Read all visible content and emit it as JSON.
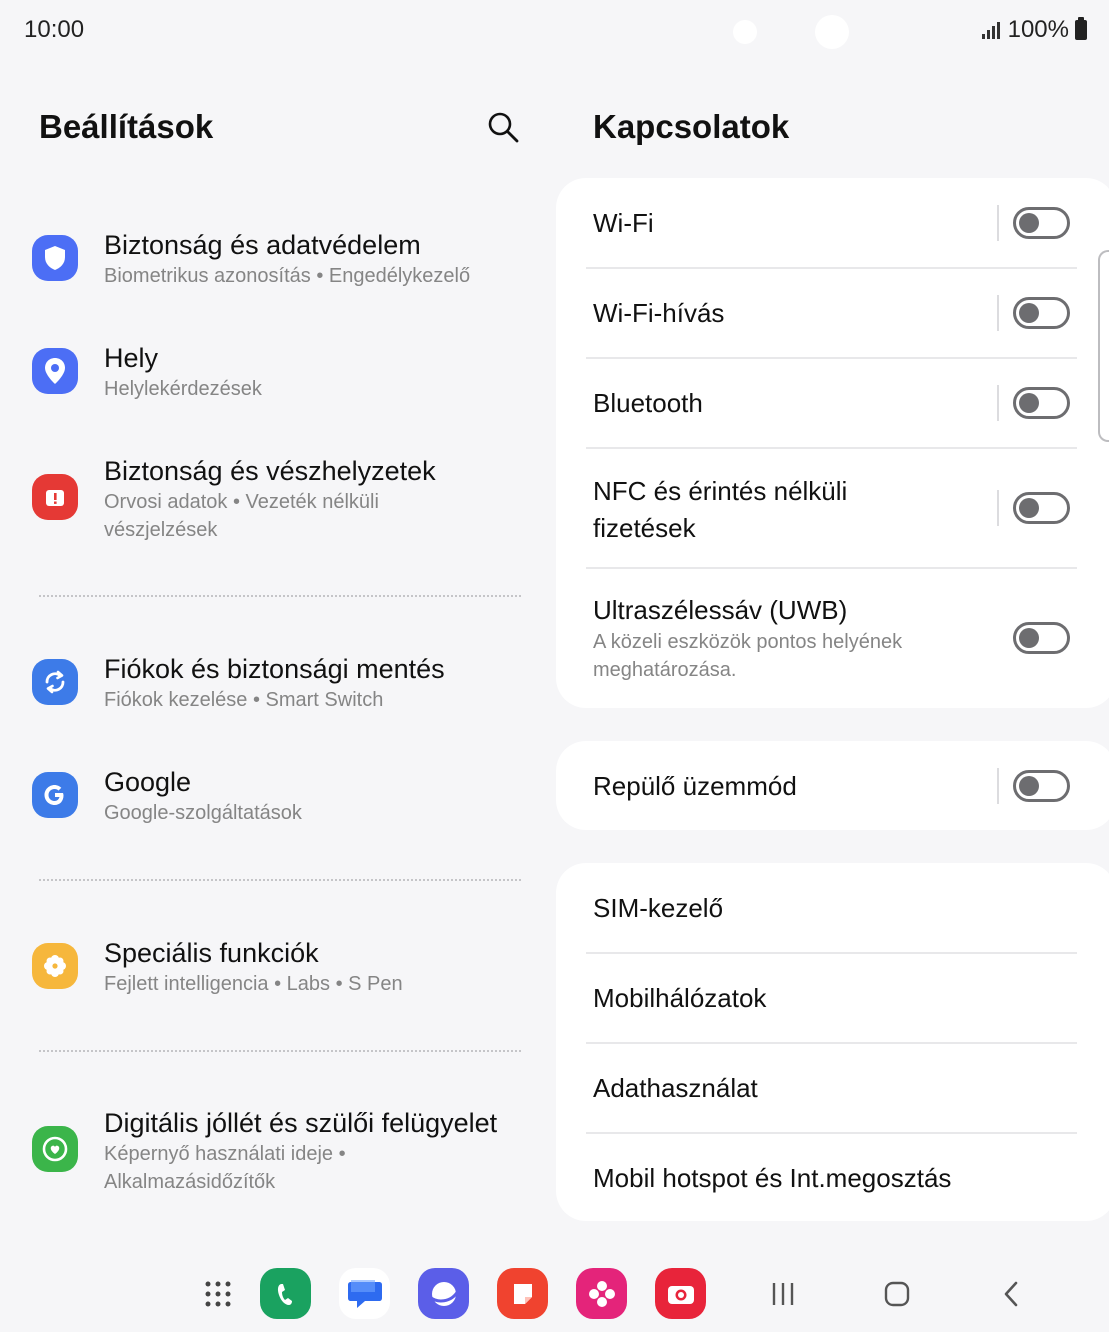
{
  "status_bar": {
    "time": "10:00",
    "battery": "100%"
  },
  "left_pane": {
    "title": "Beállítások",
    "items": [
      {
        "title": "Biztonság és adatvédelem",
        "subtitle": "Biometrikus azonosítás  •  Engedélykezelő",
        "icon": "shield-icon",
        "color": "#4c6ef5"
      },
      {
        "title": "Hely",
        "subtitle": "Helylekérdezések",
        "icon": "location-pin-icon",
        "color": "#4c6ef5"
      },
      {
        "title": "Biztonság és vészhelyzetek",
        "subtitle": "Orvosi adatok  •  Vezeték nélküli vészjelzések",
        "icon": "emergency-alert-icon",
        "color": "#e53935"
      },
      {
        "title": "Fiókok és biztonsági mentés",
        "subtitle": "Fiókok kezelése  •  Smart Switch",
        "icon": "sync-icon",
        "color": "#3d7be8"
      },
      {
        "title": "Google",
        "subtitle": "Google-szolgáltatások",
        "icon": "google-g-icon",
        "color": "#3d7be8"
      },
      {
        "title": "Speciális funkciók",
        "subtitle": "Fejlett intelligencia  •  Labs  •  S Pen",
        "icon": "gear-flower-icon",
        "color": "#f6b73c"
      },
      {
        "title": "Digitális jóllét és szülői felügyelet",
        "subtitle": "Képernyő használati ideje  •  Alkalmazásidőzítők",
        "icon": "heart-circle-icon",
        "color": "#3bb54a"
      }
    ]
  },
  "right_pane": {
    "title": "Kapcsolatok",
    "group1": [
      {
        "label": "Wi-Fi",
        "toggle": "off"
      },
      {
        "label": "Wi-Fi-hívás",
        "toggle": "off"
      },
      {
        "label": "Bluetooth",
        "toggle": "off"
      },
      {
        "label": "NFC és érintés nélküli fizetések",
        "toggle": "off"
      },
      {
        "label": "Ultraszélessáv (UWB)",
        "subtitle": "A közeli eszközök pontos helyének meghatározása.",
        "toggle": "off"
      }
    ],
    "group2": [
      {
        "label": "Repülő üzemmód",
        "toggle": "off"
      }
    ],
    "group3": [
      {
        "label": "SIM-kezelő"
      },
      {
        "label": "Mobilhálózatok"
      },
      {
        "label": "Adathasználat"
      },
      {
        "label": "Mobil hotspot és Int.megosztás"
      }
    ]
  },
  "dock": {
    "apps": [
      "apps-grid-icon",
      "phone-icon",
      "messages-icon",
      "internet-icon",
      "notes-icon",
      "gallery-icon",
      "camera-icon"
    ],
    "nav": [
      "recent-apps-icon",
      "home-icon",
      "back-icon"
    ]
  }
}
